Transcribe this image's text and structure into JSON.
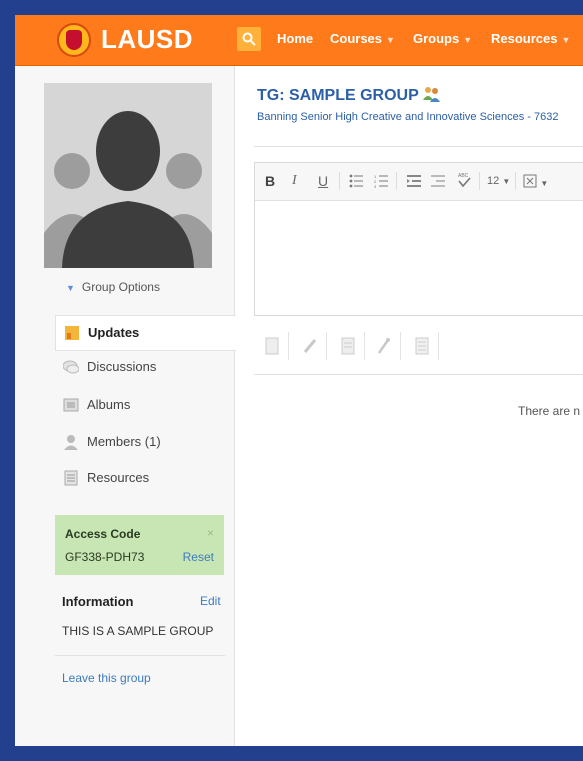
{
  "header": {
    "brand": "LAUSD",
    "nav": [
      {
        "label": "Home",
        "has_menu": false
      },
      {
        "label": "Courses",
        "has_menu": true
      },
      {
        "label": "Groups",
        "has_menu": true
      },
      {
        "label": "Resources",
        "has_menu": true
      }
    ],
    "colors": {
      "bar": "#ff7a1a",
      "frame": "#23408e"
    }
  },
  "sidebar": {
    "group_options": "Group Options",
    "menu": [
      {
        "label": "Updates",
        "icon": "updates-icon",
        "active": true
      },
      {
        "label": "Discussions",
        "icon": "discussions-icon",
        "active": false
      },
      {
        "label": "Albums",
        "icon": "albums-icon",
        "active": false
      },
      {
        "label": "Members (1)",
        "icon": "members-icon",
        "active": false
      },
      {
        "label": "Resources",
        "icon": "resources-icon",
        "active": false
      }
    ],
    "access_code": {
      "title": "Access Code",
      "code": "GF338-PDH73",
      "reset": "Reset",
      "close": "×"
    },
    "information": {
      "title": "Information",
      "edit": "Edit",
      "text": "THIS IS A SAMPLE GROUP"
    },
    "leave": "Leave this group"
  },
  "main": {
    "title": "TG: SAMPLE GROUP",
    "subtitle": "Banning Senior High Creative and Innovative Sciences - 7632",
    "editor": {
      "tools": [
        "B",
        "I",
        "U",
        "bullet-list-icon",
        "numbered-list-icon",
        "indent-icon",
        "outdent-icon",
        "spellcheck-icon",
        "12",
        "insert-icon"
      ],
      "font_size": "12"
    },
    "attachments": [
      "file-icon",
      "link-icon",
      "document-icon",
      "pen-icon",
      "list-icon"
    ],
    "empty_message": "There are n"
  }
}
